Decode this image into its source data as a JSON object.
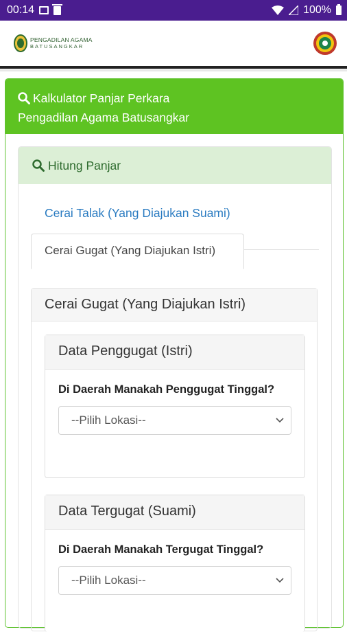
{
  "status_bar": {
    "time": "00:14",
    "battery": "100%"
  },
  "header": {
    "brand_line1": "PENGADILAN AGAMA",
    "brand_line2": "BATUSANGKAR"
  },
  "card": {
    "title_line1": "Kalkulator Panjar Perkara",
    "title_line2": "Pengadilan Agama Batusangkar"
  },
  "section": {
    "title": "Hitung Panjar"
  },
  "tabs": [
    {
      "label": "Cerai Talak (Yang Diajukan Suami)",
      "active": false
    },
    {
      "label": "Cerai Gugat (Yang Diajukan Istri)",
      "active": true
    }
  ],
  "panel": {
    "title": "Cerai Gugat (Yang Diajukan Istri)",
    "penggugat": {
      "title": "Data Penggugat (Istri)",
      "question": "Di Daerah Manakah Penggugat Tinggal?",
      "select_value": "--Pilih Lokasi--"
    },
    "tergugat": {
      "title": "Data Tergugat (Suami)",
      "question": "Di Daerah Manakah Tergugat Tinggal?",
      "select_value": "--Pilih Lokasi--"
    }
  },
  "colors": {
    "status_bar": "#4a1d8f",
    "primary_green": "#5ec322",
    "light_green": "#dcefd6",
    "link_blue": "#2a7bc1"
  }
}
